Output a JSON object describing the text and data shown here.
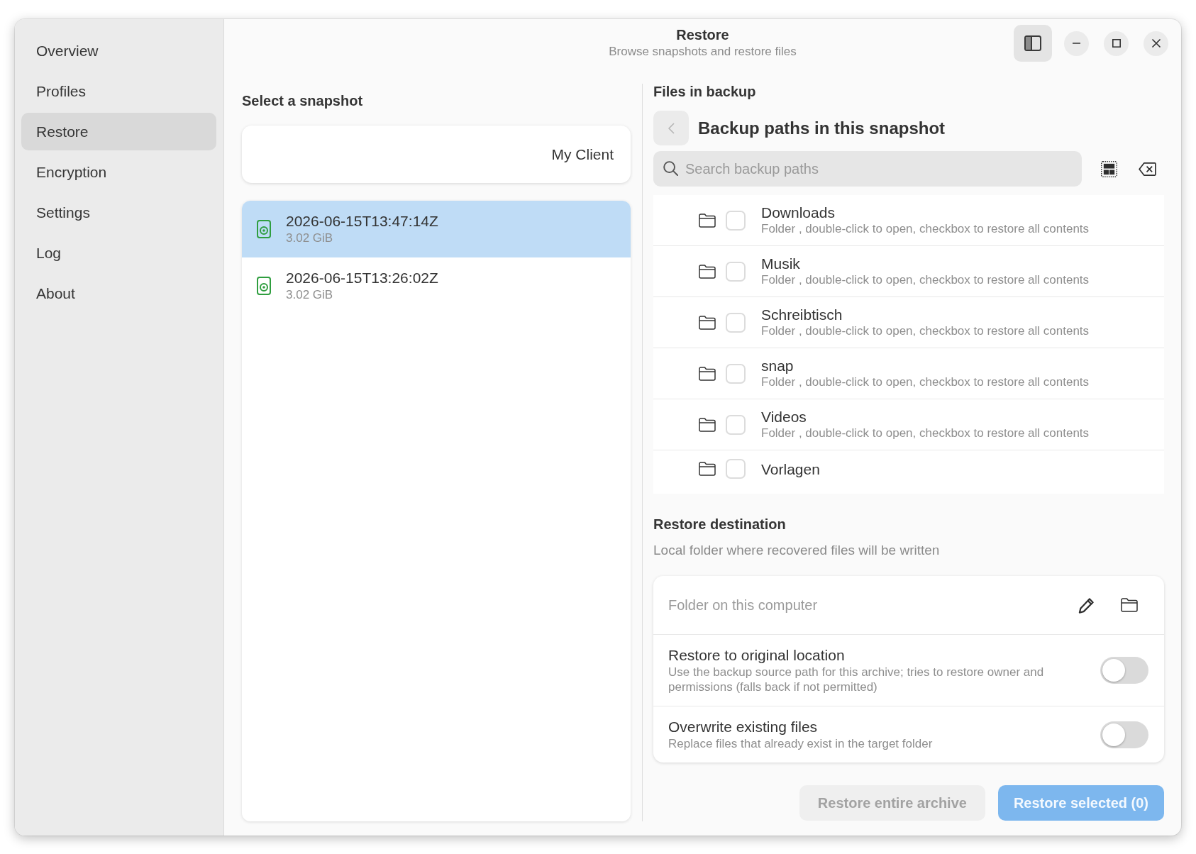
{
  "window": {
    "title": "Restore",
    "subtitle": "Browse snapshots and restore files",
    "sidebar_toggle": {
      "active": true
    }
  },
  "sidebar": {
    "items": [
      {
        "label": "Overview",
        "selected": false
      },
      {
        "label": "Profiles",
        "selected": false
      },
      {
        "label": "Restore",
        "selected": true
      },
      {
        "label": "Encryption",
        "selected": false
      },
      {
        "label": "Settings",
        "selected": false
      },
      {
        "label": "Log",
        "selected": false
      },
      {
        "label": "About",
        "selected": false
      }
    ]
  },
  "snapshot_panel": {
    "heading": "Select a snapshot",
    "client": "My Client",
    "snapshots": [
      {
        "title": "2026-06-15T13:47:14Z",
        "size": "3.02 GiB",
        "selected": true
      },
      {
        "title": "2026-06-15T13:26:02Z",
        "size": "3.02 GiB",
        "selected": false
      }
    ]
  },
  "files_panel": {
    "heading": "Files in backup",
    "back_button": {
      "disabled": true
    },
    "title": "Backup paths in this snapshot",
    "search": {
      "placeholder": "Search backup paths"
    },
    "items": [
      {
        "name": "Downloads",
        "description": "Folder , double-click to open, checkbox to restore all contents",
        "checked": false
      },
      {
        "name": "Musik",
        "description": "Folder , double-click to open, checkbox to restore all contents",
        "checked": false
      },
      {
        "name": "Schreibtisch",
        "description": "Folder , double-click to open, checkbox to restore all contents",
        "checked": false
      },
      {
        "name": "snap",
        "description": "Folder , double-click to open, checkbox to restore all contents",
        "checked": false
      },
      {
        "name": "Videos",
        "description": "Folder , double-click to open, checkbox to restore all contents",
        "checked": false
      },
      {
        "name": "Vorlagen",
        "checked": false
      }
    ]
  },
  "restore_destination": {
    "heading": "Restore destination",
    "subtitle": "Local folder where recovered files will be written",
    "folder_field": {
      "placeholder": "Folder on this computer"
    },
    "options": [
      {
        "title": "Restore to original location",
        "description": "Use the backup source path for this archive; tries to restore owner and permissions (falls back if not permitted)",
        "on": false
      },
      {
        "title": "Overwrite existing files",
        "description": "Replace files that already exist in the target folder",
        "on": false
      }
    ]
  },
  "buttons": [
    {
      "label": "Restore entire archive",
      "kind": "normal",
      "disabled": true
    },
    {
      "label": "Restore selected (0)",
      "kind": "suggested",
      "disabled": true
    }
  ]
}
